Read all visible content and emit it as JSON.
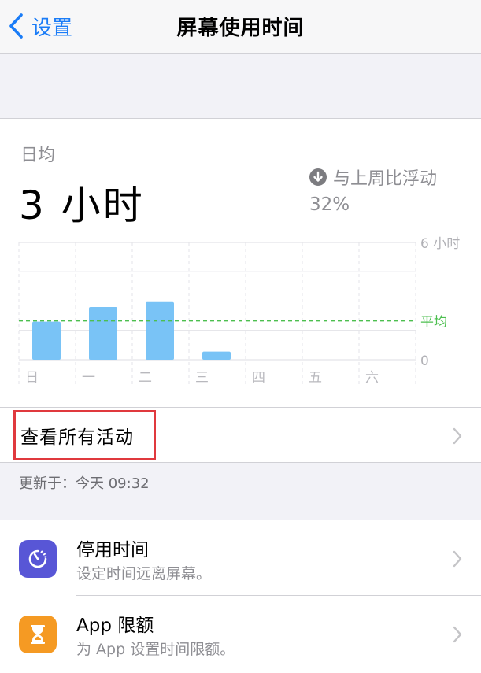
{
  "nav": {
    "back_label": "设置",
    "title": "屏幕使用时间"
  },
  "summary": {
    "daily_label": "日均",
    "daily_value": "3 小时",
    "compare_label": "与上周比浮动",
    "compare_value": "32%"
  },
  "chart_data": {
    "type": "bar",
    "categories": [
      "日",
      "一",
      "二",
      "三",
      "四",
      "五",
      "六"
    ],
    "values": [
      1.95,
      2.7,
      2.95,
      0.42,
      0,
      0,
      0
    ],
    "ylim": [
      0,
      6
    ],
    "y_top_label": "6 小时",
    "y_bottom_label": "0",
    "average": 2.0,
    "average_label": "平均",
    "colors": {
      "bar": "#79c3f6",
      "average": "#4cbf4f",
      "grid": "#dedee3"
    }
  },
  "activity": {
    "label": "查看所有活动"
  },
  "updated": "更新于：今天 09:32",
  "list": {
    "items": [
      {
        "title": "停用时间",
        "subtitle": "设定时间远离屏幕。",
        "icon": "downtime-icon",
        "color": "#5856d6"
      },
      {
        "title": "App 限额",
        "subtitle": "为 App 设置时间限额。",
        "icon": "hourglass-icon",
        "color": "#f59a23"
      }
    ]
  }
}
